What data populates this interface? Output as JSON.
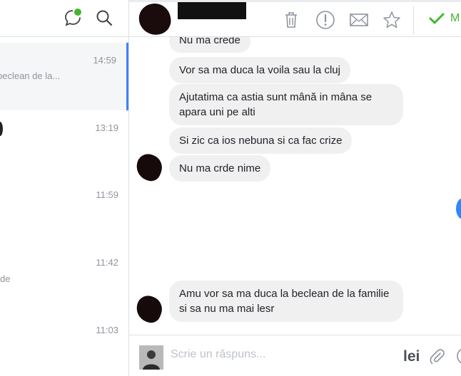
{
  "conversations": [
    {
      "time": "14:59",
      "snippet": "beclean de la..."
    },
    {
      "time": "13:19",
      "snippet": ""
    },
    {
      "time": "11:59",
      "snippet": ""
    },
    {
      "time": "11:42",
      "snippet": "de"
    },
    {
      "time": "11:03",
      "snippet": ""
    }
  ],
  "header": {
    "mark_read_label": "M"
  },
  "messages": [
    "Nu ma crede",
    "Vor sa ma duca la voila sau la cluj",
    "Ajutatima ca astia sunt mână in mâna se apara uni pe alti",
    "Si zic ca ios nebuna si ca fac crize",
    "Nu ma crde nime",
    "Amu vor sa ma duca la beclean de la familie si sa nu ma mai lesr"
  ],
  "composer": {
    "placeholder": "Scrie un răspuns...",
    "currency_label": "lei"
  },
  "colors": {
    "accent": "#4080ff",
    "check": "#42b72a",
    "bubble": "#f1f0f0"
  }
}
